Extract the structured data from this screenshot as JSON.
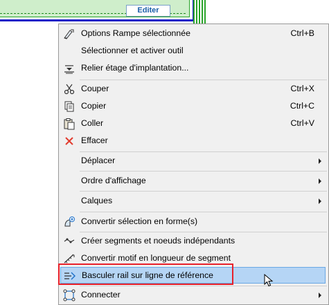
{
  "canvas": {
    "edit_tag": "Editer"
  },
  "menu": {
    "items": [
      {
        "label": "Options Rampe sélectionnée",
        "shortcut": "Ctrl+B",
        "icon": "ramp-settings-icon"
      },
      {
        "label": "Sélectionner et activer outil",
        "shortcut": "",
        "icon": ""
      },
      {
        "label": "Relier étage d'implantation...",
        "shortcut": "",
        "icon": "story-link-icon"
      },
      {
        "label": "Couper",
        "shortcut": "Ctrl+X",
        "icon": "scissors-icon"
      },
      {
        "label": "Copier",
        "shortcut": "Ctrl+C",
        "icon": "copy-icon"
      },
      {
        "label": "Coller",
        "shortcut": "Ctrl+V",
        "icon": "paste-icon"
      },
      {
        "label": "Effacer",
        "shortcut": "",
        "icon": "delete-icon"
      },
      {
        "label": "Déplacer",
        "shortcut": "",
        "icon": "",
        "submenu": true
      },
      {
        "label": "Ordre d'affichage",
        "shortcut": "",
        "icon": "",
        "submenu": true
      },
      {
        "label": "Calques",
        "shortcut": "",
        "icon": "",
        "submenu": true
      },
      {
        "label": "Convertir sélection en forme(s)",
        "shortcut": "",
        "icon": "convert-shape-icon"
      },
      {
        "label": "Créer segments et noeuds indépendants",
        "shortcut": "",
        "icon": "segments-nodes-icon"
      },
      {
        "label": "Convertir motif en longueur de segment",
        "shortcut": "",
        "icon": "pattern-length-icon"
      },
      {
        "label": "Basculer rail sur ligne de référence",
        "shortcut": "",
        "icon": "switch-rail-icon",
        "highlighted": true
      },
      {
        "label": "Connecter",
        "shortcut": "",
        "icon": "connect-icon",
        "submenu": true
      }
    ]
  },
  "colors": {
    "highlight": "#b5d5f5",
    "annotation_box": "#e8202a",
    "ramp_outline": "#1418c8",
    "rail_green": "#29a329"
  }
}
